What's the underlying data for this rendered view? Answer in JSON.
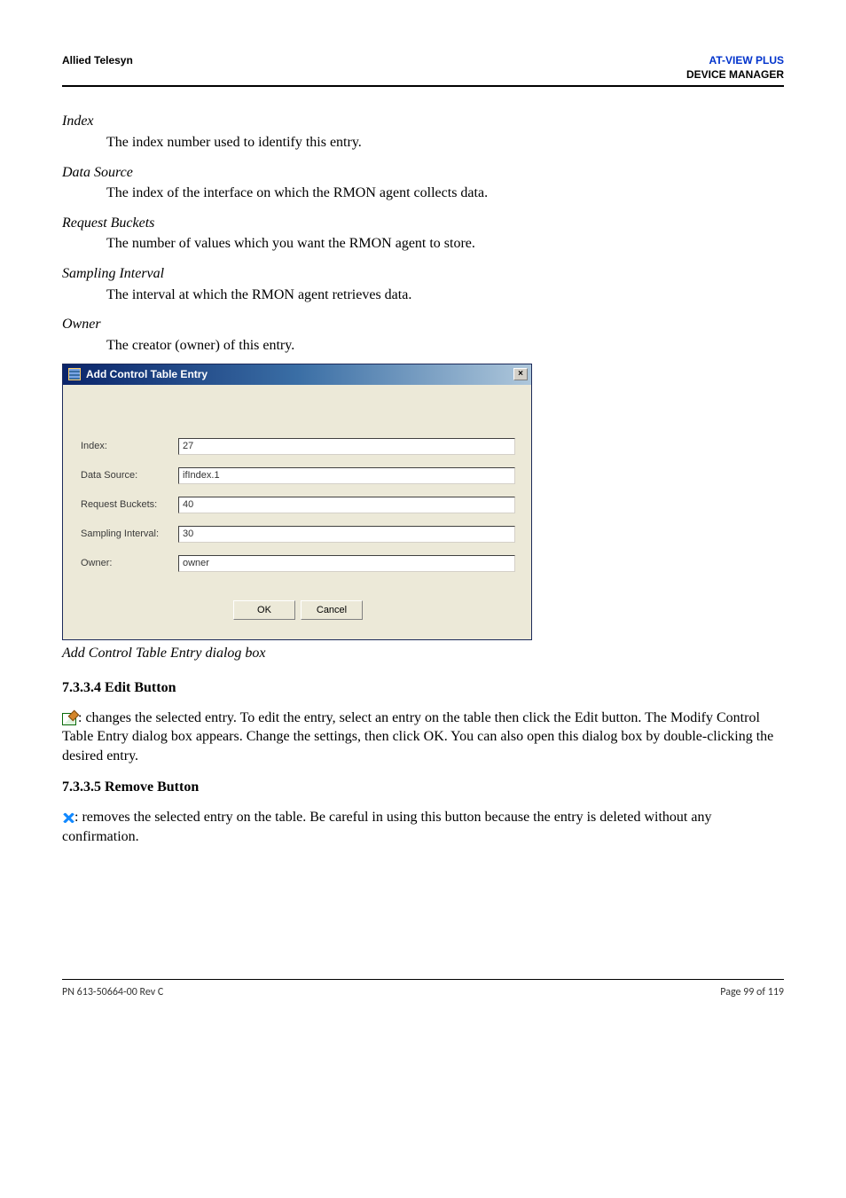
{
  "header": {
    "left": "Allied Telesyn",
    "right_line1": "AT-VIEW PLUS",
    "right_line2": "DEVICE MANAGER"
  },
  "definitions": {
    "index": {
      "term": "Index",
      "desc": "The index number used to identify this entry."
    },
    "data_source": {
      "term": "Data Source",
      "desc": "The index of the interface on which the RMON agent collects data."
    },
    "request_buckets": {
      "term": "Request Buckets",
      "desc": "The number of values which you want the RMON agent to store."
    },
    "sampling_interval": {
      "term": "Sampling Interval",
      "desc": "The interval at which the RMON agent retrieves data."
    },
    "owner": {
      "term": "Owner",
      "desc": "The creator (owner) of this entry."
    }
  },
  "dialog": {
    "title": "Add Control Table Entry",
    "fields": {
      "index": {
        "label": "Index:",
        "value": "27"
      },
      "data_source": {
        "label": "Data Source:",
        "value": "ifIndex.1"
      },
      "request_buckets": {
        "label": "Request Buckets:",
        "value": "40"
      },
      "sampling_interval": {
        "label": "Sampling Interval:",
        "value": "30"
      },
      "owner": {
        "label": "Owner:",
        "value": "owner"
      }
    },
    "buttons": {
      "ok": "OK",
      "cancel": "Cancel"
    },
    "caption": "Add Control Table Entry dialog box"
  },
  "sections": {
    "edit": {
      "heading": "7.3.3.4 Edit Button",
      "body": ": changes the selected entry. To edit the entry, select an entry on the table then click the Edit button. The Modify Control Table Entry dialog box appears. Change the settings, then click OK. You can also open this dialog box by double-clicking the desired entry."
    },
    "remove": {
      "heading": "7.3.3.5 Remove Button",
      "body": ": removes the selected entry on the table. Be careful in using this button because the entry is deleted without any confirmation."
    }
  },
  "footer": {
    "left": "PN 613-50664-00 Rev C",
    "right": "Page 99 of 119"
  }
}
